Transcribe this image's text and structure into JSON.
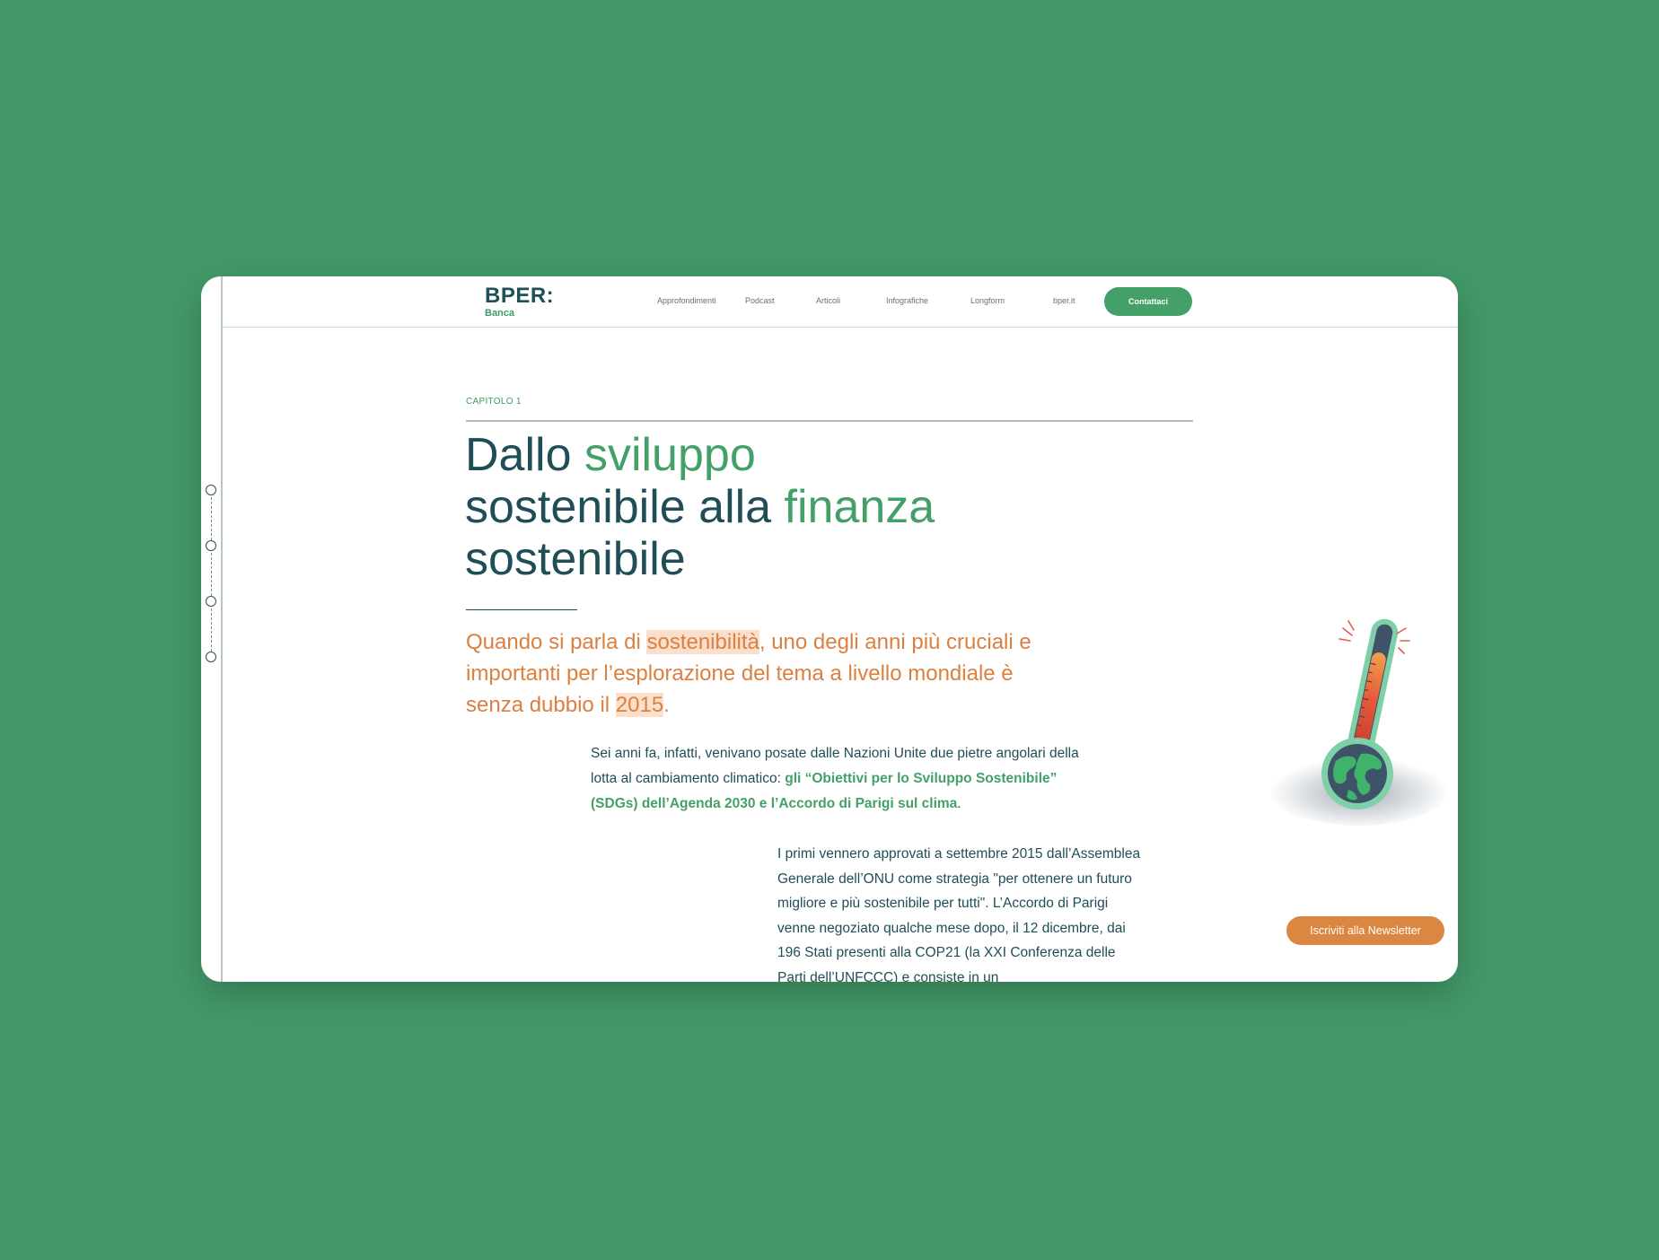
{
  "header": {
    "logo_main": "BPER:",
    "logo_sub": "Banca",
    "nav": [
      "Approfondimenti",
      "Podcast",
      "Articoli",
      "Infografiche",
      "Longform",
      "bper.it"
    ],
    "cta": "Contattaci"
  },
  "article": {
    "chapter": "CAPITOLO 1",
    "title": {
      "l1a": "Dallo ",
      "l1b": "sviluppo",
      "l2a": "sostenibile alla ",
      "l2b": "finanza",
      "l3": "sostenibile"
    },
    "lead": {
      "p1": "Quando si parla di ",
      "m1": "sostenibilità",
      "p2": ", uno degli anni più cruciali e importanti per l’esplorazione del tema a livello mondiale è senza dubbio il ",
      "m2": "2015",
      "p3": "."
    },
    "para1": {
      "text": "Sei anni fa, infatti, venivano posate dalle Nazioni Unite due pietre angolari della lotta al cambiamento climatico: ",
      "link": "gli “Obiettivi per lo Sviluppo Sostenibile” (SDGs) dell’Agenda 2030 e l’Accordo di Parigi sul clima",
      "end": "."
    },
    "para2": "I primi vennero approvati a settembre 2015 dall’Assemblea Generale dell’ONU come strategia \"per ottenere un futuro migliore e più sostenibile per tutti\". L’Accordo di Parigi venne negoziato qualche mese dopo, il 12 dicembre, dai 196 Stati presenti alla COP21 (la XXI Conferenza delle Parti dell’UNFCCC) e consiste in un"
  },
  "newsletter": "Iscriviti alla Newsletter",
  "illustration_icon": "thermometer-earth-icon",
  "colors": {
    "background": "#439968",
    "primary": "#1f4e57",
    "accent_green": "#43a068",
    "accent_orange": "#dc7f3f",
    "highlight": "#fae0cc"
  }
}
